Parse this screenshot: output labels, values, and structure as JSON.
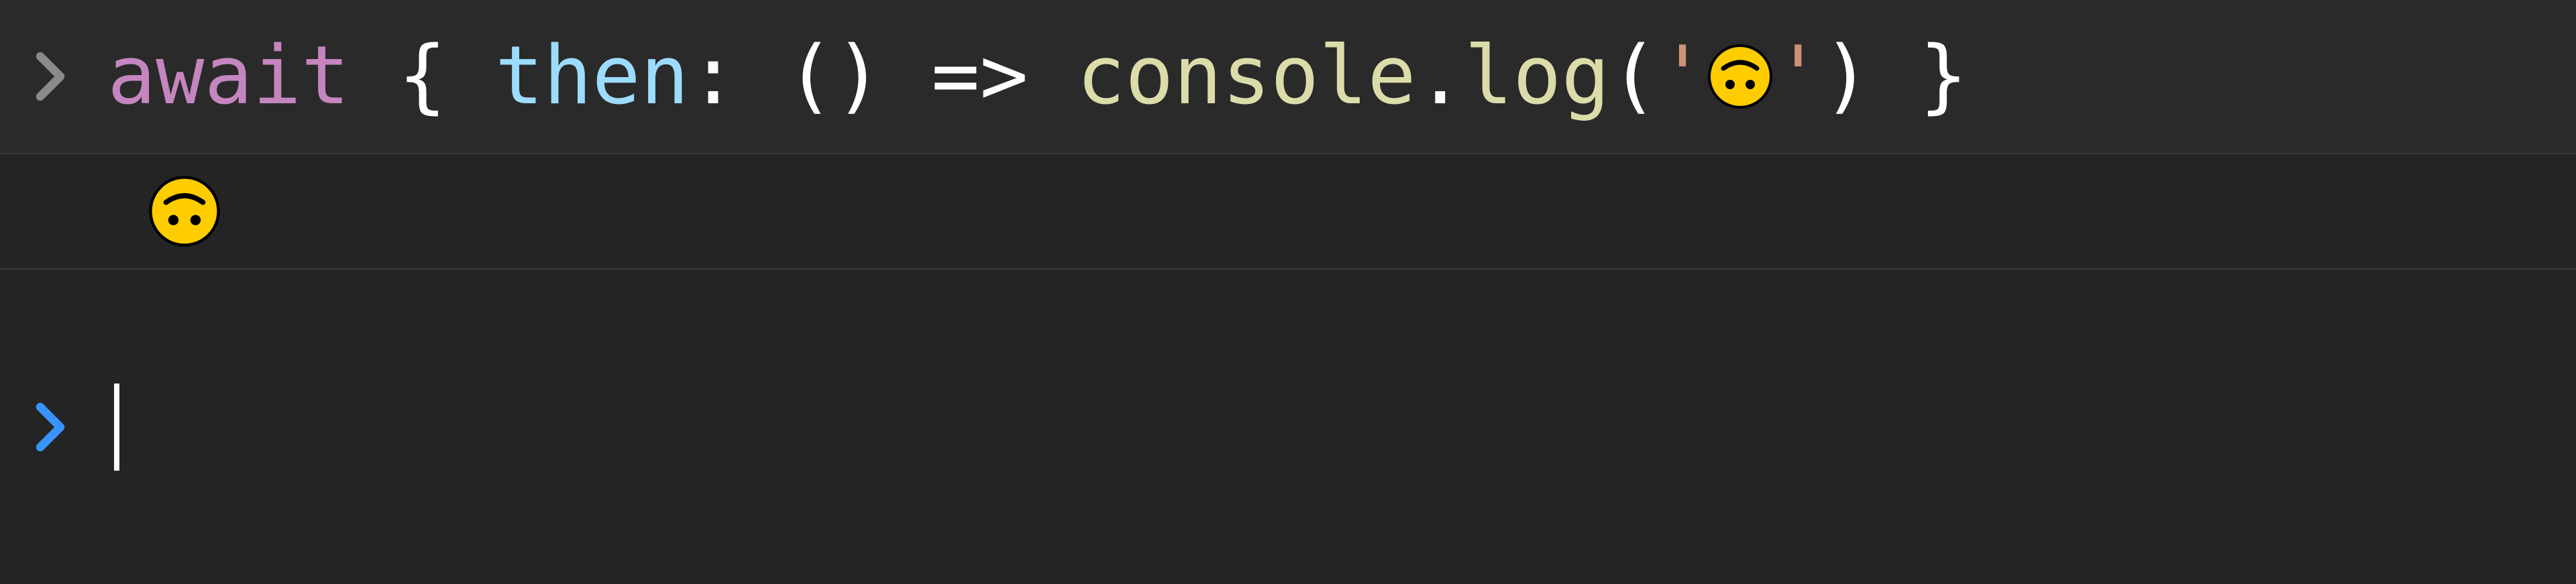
{
  "console": {
    "input": {
      "tokens": {
        "await": "await",
        "space1": " ",
        "braceOpen": "{",
        "space2": " ",
        "then": "then",
        "colon": ":",
        "space3": " ",
        "parenOpen": "(",
        "parenClose": ")",
        "space4": " ",
        "arrow": "=>",
        "space5": " ",
        "console": "console",
        "dot": ".",
        "log": "log",
        "parenOpen2": "(",
        "stringOpen": "'",
        "stringClose": "'",
        "parenClose2": ")",
        "space6": " ",
        "braceClose": "}"
      },
      "emoji": "🙃"
    },
    "output": {
      "emoji": "🙃"
    },
    "prompt": {
      "value": ""
    }
  }
}
